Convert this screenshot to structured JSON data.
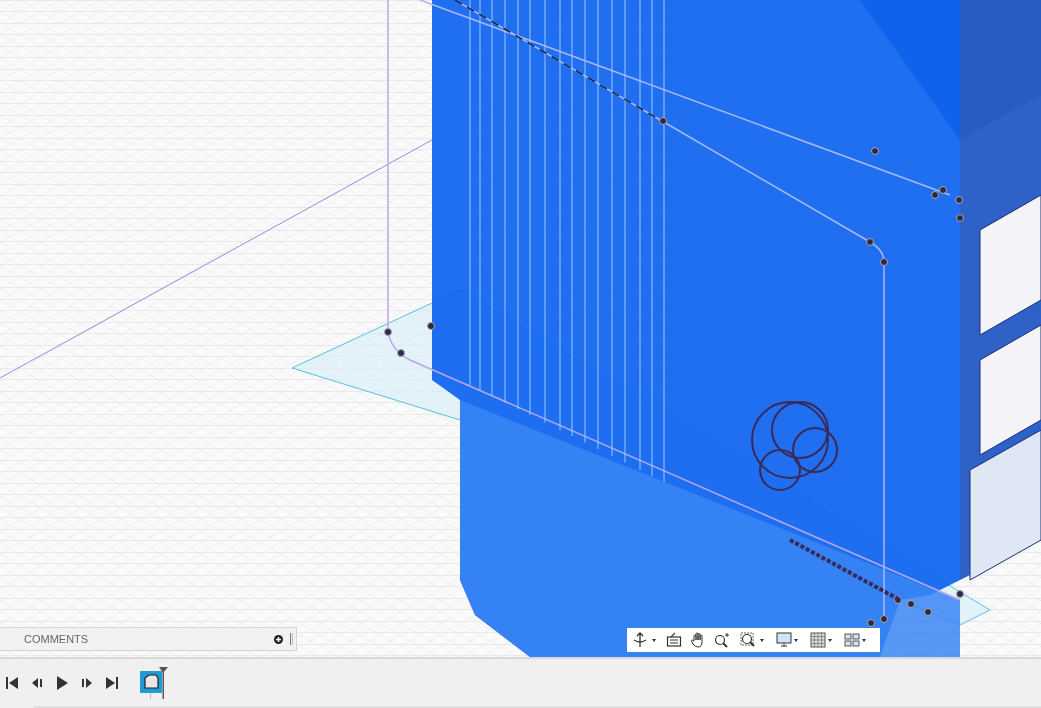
{
  "comments_panel": {
    "title": "COMMENTS"
  }
}
